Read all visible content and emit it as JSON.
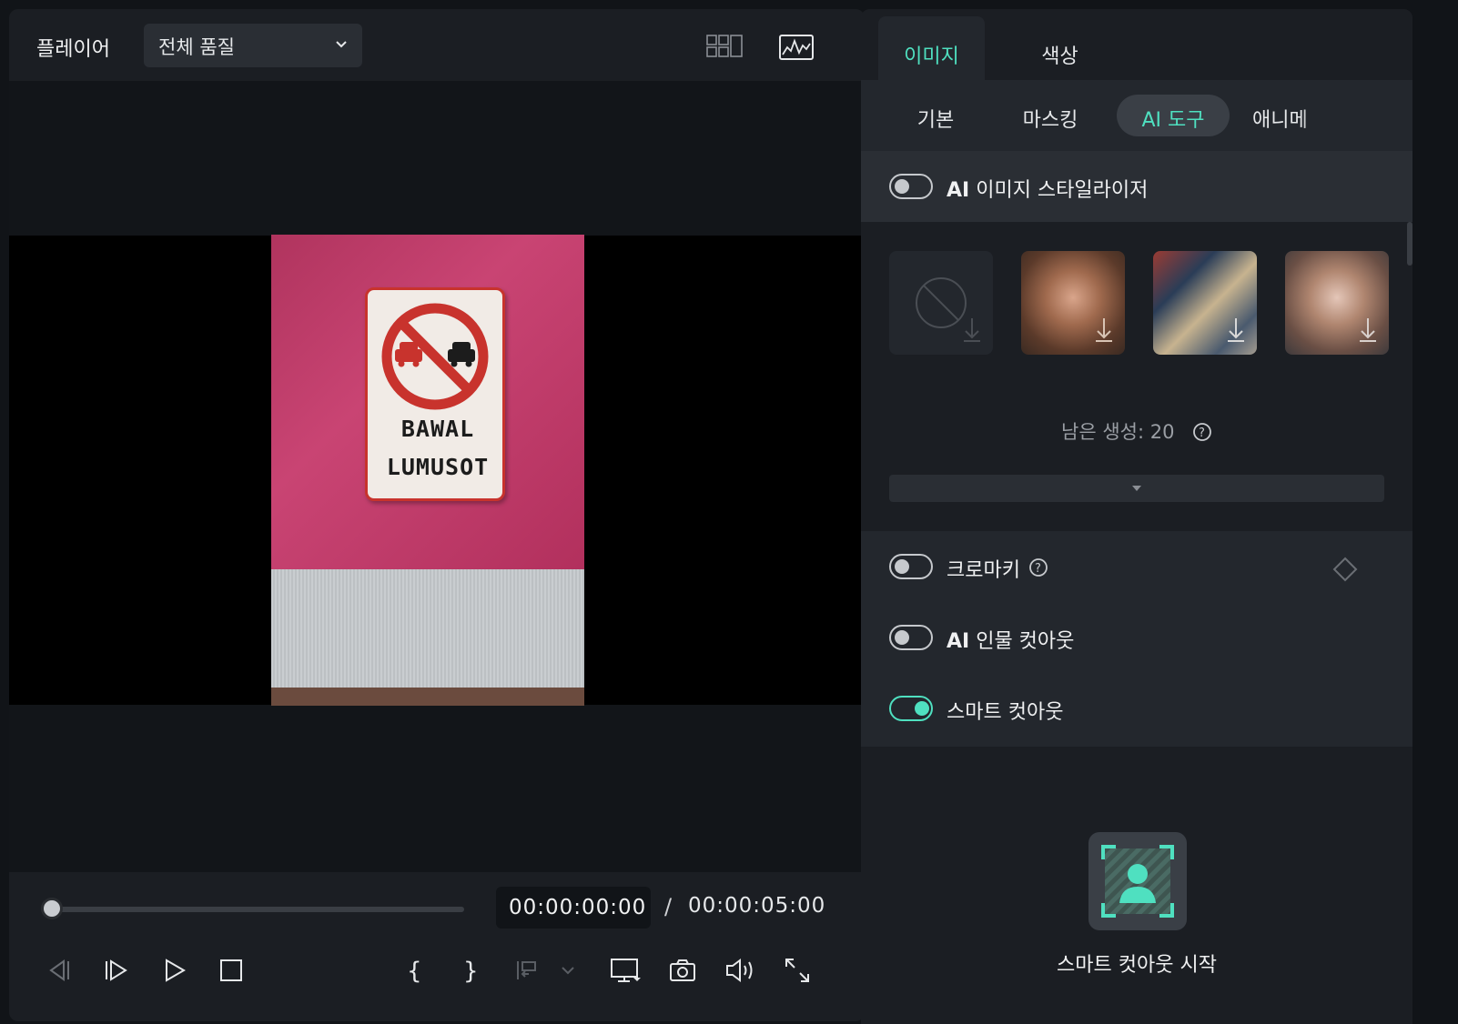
{
  "player": {
    "title": "플레이어",
    "quality_label": "전체 품질",
    "current_time": "00:00:00:00",
    "separator": "/",
    "duration": "00:00:05:00",
    "progress": 0,
    "sign_line1": "BAWAL",
    "sign_line2": "LUMUSOT"
  },
  "panel": {
    "tabs": [
      {
        "label": "이미지",
        "active": true
      },
      {
        "label": "색상",
        "active": false
      }
    ],
    "subtabs": [
      {
        "label": "기본"
      },
      {
        "label": "마스킹"
      },
      {
        "label": "AI 도구",
        "active": true
      },
      {
        "label": "애니메"
      }
    ],
    "stylizer": {
      "prefix": "AI",
      "label": " 이미지 스타일라이저",
      "on": false
    },
    "remaining": "남은 생성: 20",
    "chroma": {
      "label": "크로마키",
      "on": false
    },
    "person_cutout": {
      "prefix": "AI",
      "label": " 인물 컷아웃",
      "on": false
    },
    "smart_cutout": {
      "label": "스마트 컷아웃",
      "on": true
    },
    "smart_cutout_start": "스마트 컷아웃 시작"
  },
  "colors": {
    "accent": "#4fe0c0",
    "bg": "#111418",
    "panel": "#23272d"
  }
}
